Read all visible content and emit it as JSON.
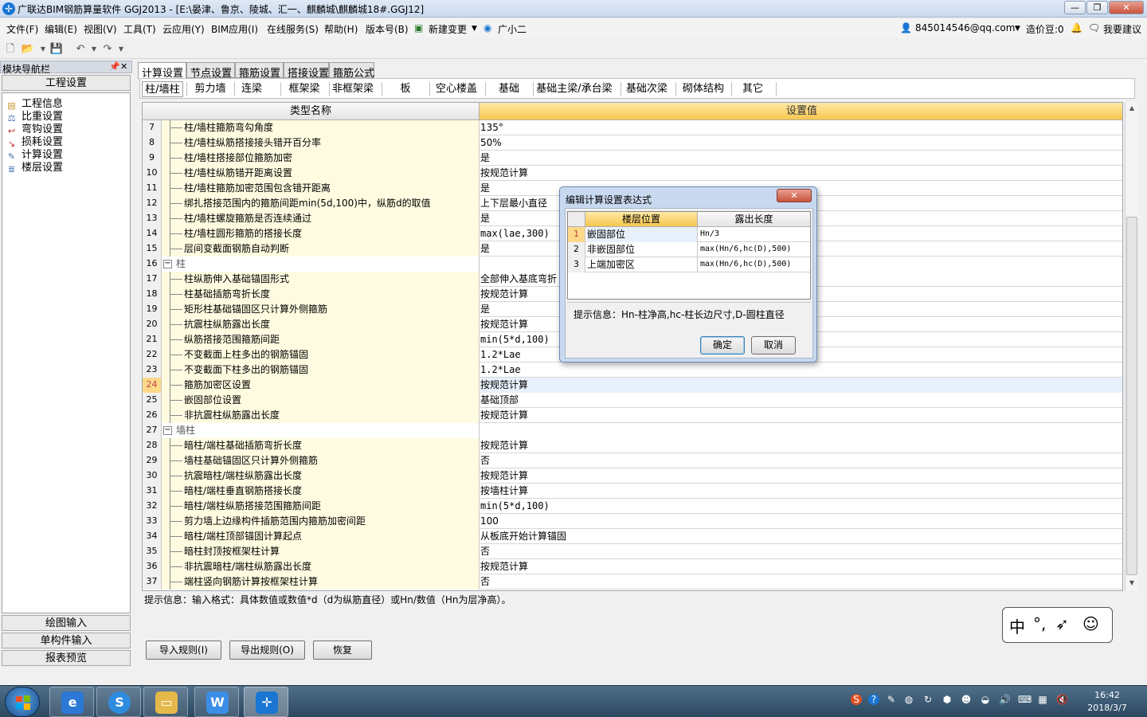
{
  "window": {
    "title": "广联达BIM钢筋算量软件 GGJ2013 - [E:\\晏津、鲁京、陵城、汇一、麒麟城\\麒麟城18#.GGJ12]",
    "min": "—",
    "max": "❐",
    "close": "✕"
  },
  "menu": [
    "文件(F)",
    "编辑(E)",
    "视图(V)",
    "工具(T)",
    "云应用(Y)",
    "BIM应用(I)",
    "在线服务(S)",
    "帮助(H)",
    "版本号(B)",
    "新建变更",
    "广小二"
  ],
  "user": {
    "account": "845014546@qq.com",
    "credits": "造价豆:0",
    "feedback": "我要建议"
  },
  "nav": {
    "title": "模块导航栏",
    "group": "工程设置",
    "items": [
      "工程信息",
      "比重设置",
      "弯钩设置",
      "损耗设置",
      "计算设置",
      "楼层设置"
    ],
    "bottom": [
      "绘图输入",
      "单构件输入",
      "报表预览"
    ]
  },
  "tabs": [
    "计算设置",
    "节点设置",
    "箍筋设置",
    "搭接设置",
    "箍筋公式"
  ],
  "subtabs": [
    "柱/墙柱",
    "剪力墙",
    "连梁",
    "框架梁",
    "非框架梁",
    "板",
    "空心楼盖",
    "基础",
    "基础主梁/承台梁",
    "基础次梁",
    "砌体结构",
    "其它"
  ],
  "grid": {
    "col_name": "类型名称",
    "col_value": "设置值",
    "rows": [
      {
        "n": "7",
        "name": "柱/墙柱箍筋弯勾角度",
        "value": "135°"
      },
      {
        "n": "8",
        "name": "柱/墙柱纵筋搭接接头错开百分率",
        "value": "50%"
      },
      {
        "n": "9",
        "name": "柱/墙柱搭接部位箍筋加密",
        "value": "是"
      },
      {
        "n": "10",
        "name": "柱/墙柱纵筋错开距离设置",
        "value": "按规范计算"
      },
      {
        "n": "11",
        "name": "柱/墙柱箍筋加密范围包含错开距离",
        "value": "是"
      },
      {
        "n": "12",
        "name": "绑扎搭接范围内的箍筋间距min(5d,100)中，纵筋d的取值",
        "value": "上下层最小直径"
      },
      {
        "n": "13",
        "name": "柱/墙柱螺旋箍筋是否连续通过",
        "value": "是"
      },
      {
        "n": "14",
        "name": "柱/墙柱圆形箍筋的搭接长度",
        "value": "max(lae,300)"
      },
      {
        "n": "15",
        "name": "层间变截面钢筋自动判断",
        "value": "是"
      },
      {
        "n": "16",
        "name": "柱",
        "value": "",
        "group": true
      },
      {
        "n": "17",
        "name": "柱纵筋伸入基础锚固形式",
        "value": "全部伸入基底弯折"
      },
      {
        "n": "18",
        "name": "柱基础插筋弯折长度",
        "value": "按规范计算"
      },
      {
        "n": "19",
        "name": "矩形柱基础锚固区只计算外侧箍筋",
        "value": "是"
      },
      {
        "n": "20",
        "name": "抗震柱纵筋露出长度",
        "value": "按规范计算"
      },
      {
        "n": "21",
        "name": "纵筋搭接范围箍筋间距",
        "value": "min(5*d,100)"
      },
      {
        "n": "22",
        "name": "不变截面上柱多出的钢筋锚固",
        "value": "1.2*Lae"
      },
      {
        "n": "23",
        "name": "不变截面下柱多出的钢筋锚固",
        "value": "1.2*Lae"
      },
      {
        "n": "24",
        "name": "箍筋加密区设置",
        "value": "按规范计算",
        "selected": true
      },
      {
        "n": "25",
        "name": "嵌固部位设置",
        "value": "基础顶部"
      },
      {
        "n": "26",
        "name": "非抗震柱纵筋露出长度",
        "value": "按规范计算"
      },
      {
        "n": "27",
        "name": "墙柱",
        "value": "",
        "group": true
      },
      {
        "n": "28",
        "name": "暗柱/端柱基础插筋弯折长度",
        "value": "按规范计算"
      },
      {
        "n": "29",
        "name": "墙柱基础锚固区只计算外侧箍筋",
        "value": "否"
      },
      {
        "n": "30",
        "name": "抗震暗柱/端柱纵筋露出长度",
        "value": "按规范计算"
      },
      {
        "n": "31",
        "name": "暗柱/端柱垂直钢筋搭接长度",
        "value": "按墙柱计算"
      },
      {
        "n": "32",
        "name": "暗柱/端柱纵筋搭接范围箍筋间距",
        "value": "min(5*d,100)"
      },
      {
        "n": "33",
        "name": "剪力墙上边缘构件插筋范围内箍筋加密间距",
        "value": "100"
      },
      {
        "n": "34",
        "name": "暗柱/端柱顶部锚固计算起点",
        "value": "从板底开始计算锚固"
      },
      {
        "n": "35",
        "name": "暗柱封顶按框架柱计算",
        "value": "否"
      },
      {
        "n": "36",
        "name": "非抗震暗柱/端柱纵筋露出长度",
        "value": "按规范计算"
      },
      {
        "n": "37",
        "name": "端柱竖向钢筋计算按框架柱计算",
        "value": "否"
      }
    ]
  },
  "hint": "提示信息：输入格式：具体数值或数值*d（d为纵筋直径）或Hn/数值（Hn为层净高）。",
  "buttons": {
    "import": "导入规则(I)",
    "export": "导出规则(O)",
    "restore": "恢复"
  },
  "dialog": {
    "title": "编辑计算设置表达式",
    "col1": "楼层位置",
    "col2": "露出长度",
    "rows": [
      {
        "n": "1",
        "pos": "嵌固部位",
        "len": "Hn/3"
      },
      {
        "n": "2",
        "pos": "非嵌固部位",
        "len": "max(Hn/6,hc(D),500)"
      },
      {
        "n": "3",
        "pos": "上端加密区",
        "len": "max(Hn/6,hc(D),500)"
      }
    ],
    "tip": "提示信息：Hn-柱净高,hc-柱长边尺寸,D-圆柱直径",
    "ok": "确定",
    "cancel": "取消"
  },
  "ime": [
    "中",
    "°,",
    "➶",
    "☺"
  ],
  "clock": {
    "time": "16:42",
    "date": "2018/3/7"
  }
}
